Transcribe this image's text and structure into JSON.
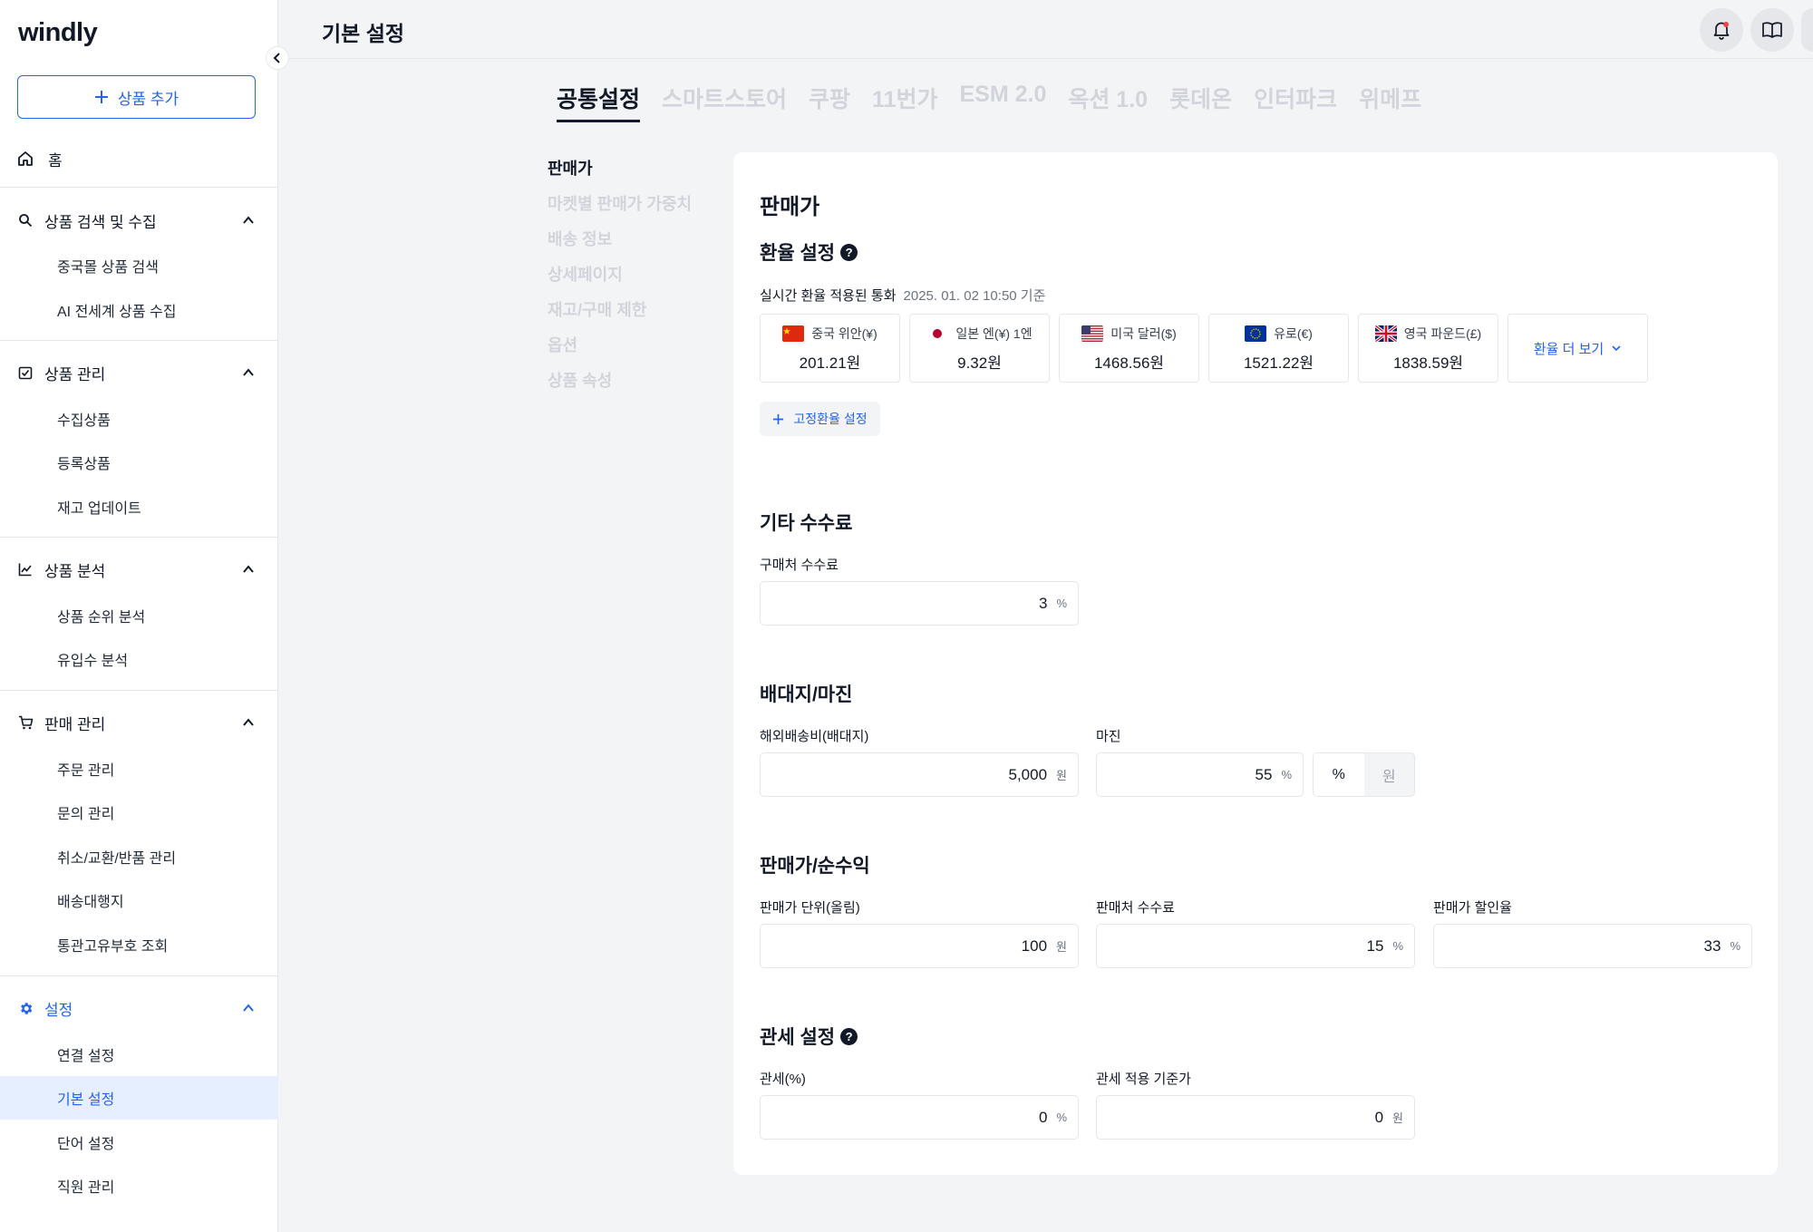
{
  "app": {
    "logo": "windly"
  },
  "sidebar": {
    "add_button_label": "상품 추가",
    "home_label": "홈",
    "groups": [
      {
        "label": "상품 검색 및 수집",
        "items": [
          "중국몰 상품 검색",
          "AI 전세계 상품 수집"
        ]
      },
      {
        "label": "상품 관리",
        "items": [
          "수집상품",
          "등록상품",
          "재고 업데이트"
        ]
      },
      {
        "label": "상품 분석",
        "items": [
          "상품 순위 분석",
          "유입수 분석"
        ]
      },
      {
        "label": "판매 관리",
        "items": [
          "주문 관리",
          "문의 관리",
          "취소/교환/반품 관리",
          "배송대행지",
          "통관고유부호 조회"
        ]
      },
      {
        "label": "설정",
        "items": [
          "연결 설정",
          "기본 설정",
          "단어 설정",
          "직원 관리"
        ]
      }
    ],
    "selected_item": "기본 설정"
  },
  "header": {
    "title": "기본 설정"
  },
  "tabs": [
    "공통설정",
    "스마트스토어",
    "쿠팡",
    "11번가",
    "ESM 2.0",
    "옥션 1.0",
    "롯데온",
    "인터파크",
    "위메프"
  ],
  "section_nav": [
    "판매가",
    "마켓별 판매가 가중치",
    "배송 정보",
    "상세페이지",
    "재고/구매 제한",
    "옵션",
    "상품 속성"
  ],
  "main": {
    "title": "판매가",
    "exchange": {
      "heading": "환율 설정",
      "caption": "실시간 환율 적용된 통화",
      "timestamp": "2025. 01. 02 10:50 기준",
      "currencies": [
        {
          "name": "중국 위안(¥)",
          "rate": "201.21원",
          "flag": "cn-flag-icon"
        },
        {
          "name": "일본 엔(¥) 1엔",
          "rate": "9.32원",
          "flag": "jp-flag-icon"
        },
        {
          "name": "미국 달러($)",
          "rate": "1468.56원",
          "flag": "us-flag-icon"
        },
        {
          "name": "유로(€)",
          "rate": "1521.22원",
          "flag": "eu-flag-icon"
        },
        {
          "name": "영국 파운드(£)",
          "rate": "1838.59원",
          "flag": "uk-flag-icon"
        }
      ],
      "more_label": "환율 더 보기",
      "fixed_rate_label": "고정환율 설정"
    },
    "other_fees": {
      "heading": "기타 수수료",
      "purchase_fee_label": "구매처 수수료",
      "purchase_fee_value": "3",
      "purchase_fee_unit": "%"
    },
    "shipping_margin": {
      "heading": "배대지/마진",
      "shipping_label": "해외배송비(배대지)",
      "shipping_value": "5,000",
      "shipping_unit": "원",
      "margin_label": "마진",
      "margin_value": "55",
      "margin_unit": "%",
      "toggle_percent": "%",
      "toggle_won": "원"
    },
    "price_profit": {
      "heading": "판매가/순수익",
      "unit_label": "판매가 단위(올림)",
      "unit_value": "100",
      "unit_unit": "원",
      "seller_fee_label": "판매처 수수료",
      "seller_fee_value": "15",
      "seller_fee_unit": "%",
      "discount_label": "판매가 할인율",
      "discount_value": "33",
      "discount_unit": "%"
    },
    "customs": {
      "heading": "관세 설정",
      "rate_label": "관세(%)",
      "rate_value": "0",
      "rate_unit": "%",
      "base_label": "관세 적용 기준가",
      "base_value": "0",
      "base_unit": "원"
    }
  },
  "colors": {
    "accent": "#2563eb",
    "selected_bg": "#e6efff",
    "page_bg": "#f3f4f6"
  }
}
